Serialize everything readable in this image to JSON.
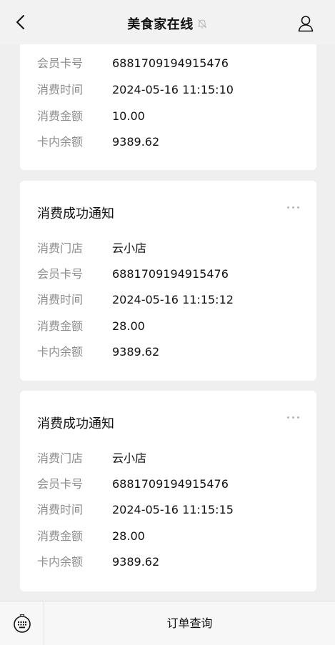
{
  "nav": {
    "title": "美食家在线",
    "back_icon": "chevron-left-icon",
    "mute_icon": "bell-off-icon",
    "profile_icon": "user-icon"
  },
  "labels": {
    "store": "消费门店",
    "card_no": "会员卡号",
    "time": "消费时间",
    "amount": "消费金额",
    "balance": "卡内余额"
  },
  "cards": [
    {
      "title": "",
      "store": "",
      "card_no": "6881709194915476",
      "time": "2024-05-16 11:15:10",
      "amount": "10.00",
      "balance": "9389.62"
    },
    {
      "title": "消费成功通知",
      "store": "云小店",
      "card_no": "6881709194915476",
      "time": "2024-05-16 11:15:12",
      "amount": "28.00",
      "balance": "9389.62"
    },
    {
      "title": "消费成功通知",
      "store": "云小店",
      "card_no": "6881709194915476",
      "time": "2024-05-16 11:15:15",
      "amount": "28.00",
      "balance": "9389.62"
    }
  ],
  "bottom": {
    "keyboard_icon": "keyboard-icon",
    "menu_label": "订单查询"
  },
  "colors": {
    "background": "#efefef",
    "card": "#ffffff",
    "label": "#8c8c8c",
    "text": "#111111"
  }
}
